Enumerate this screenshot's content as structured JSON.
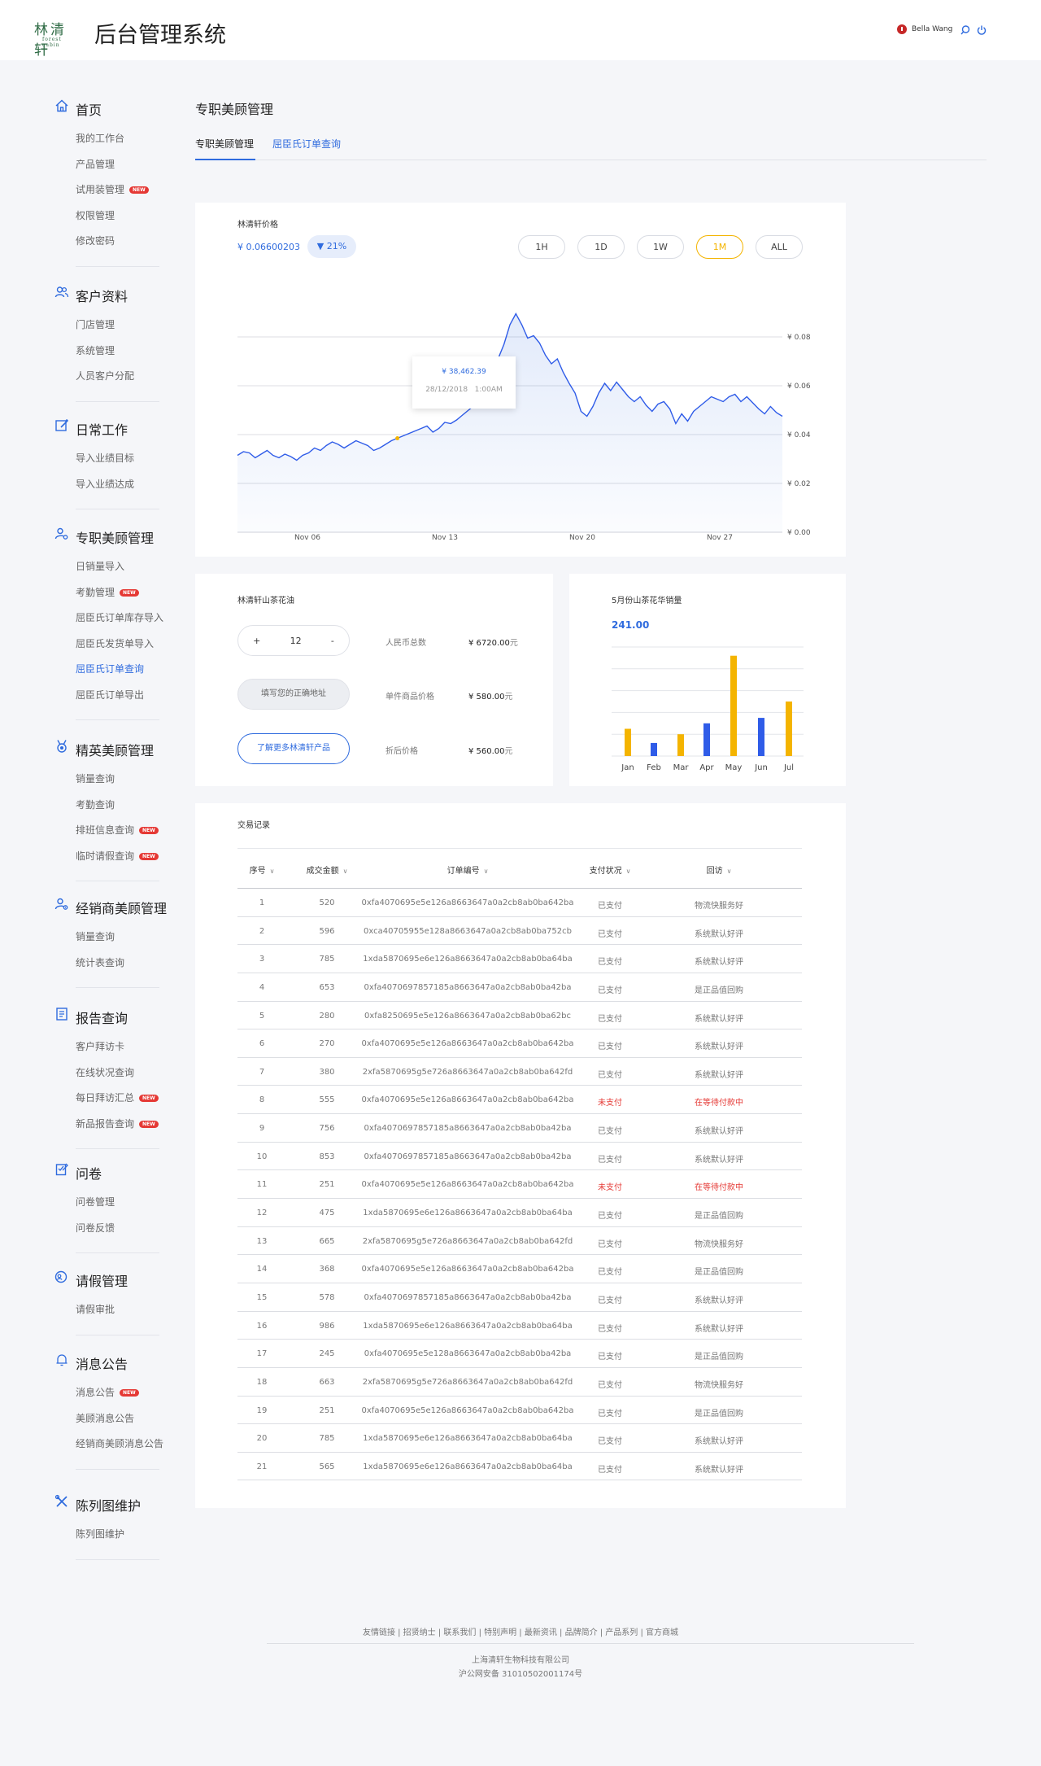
{
  "header": {
    "logo_text": "林清轩",
    "logo_sub": "forest cabin",
    "app_title": "后台管理系统",
    "user_name": "Bella Wang"
  },
  "sidebar": [
    {
      "title": "首页",
      "icon": "home-icon",
      "items": [
        {
          "label": "我的工作台"
        },
        {
          "label": "产品管理"
        },
        {
          "label": "试用装管理",
          "badge": "NEW"
        },
        {
          "label": "权限管理"
        },
        {
          "label": "修改密码"
        }
      ]
    },
    {
      "title": "客户资料",
      "icon": "users-icon",
      "items": [
        {
          "label": "门店管理"
        },
        {
          "label": "系统管理"
        },
        {
          "label": "人员客户分配"
        }
      ]
    },
    {
      "title": "日常工作",
      "icon": "edit-icon",
      "items": [
        {
          "label": "导入业绩目标"
        },
        {
          "label": "导入业绩达成"
        }
      ]
    },
    {
      "title": "专职美顾管理",
      "icon": "user-gear-icon",
      "items": [
        {
          "label": "日销量导入"
        },
        {
          "label": "考勤管理",
          "badge": "NEW"
        },
        {
          "label": "屈臣氏订单库存导入"
        },
        {
          "label": "屈臣氏发货单导入"
        },
        {
          "label": "屈臣氏订单查询",
          "active": true
        },
        {
          "label": "屈臣氏订单导出"
        }
      ]
    },
    {
      "title": "精英美顾管理",
      "icon": "medal-icon",
      "items": [
        {
          "label": "销量查询"
        },
        {
          "label": "考勤查询"
        },
        {
          "label": "排班信息查询",
          "badge": "NEW"
        },
        {
          "label": "临时请假查询",
          "badge": "NEW"
        }
      ]
    },
    {
      "title": "经销商美顾管理",
      "icon": "user-settings-icon",
      "items": [
        {
          "label": "销量查询"
        },
        {
          "label": "统计表查询"
        }
      ]
    },
    {
      "title": "报告查询",
      "icon": "report-icon",
      "items": [
        {
          "label": "客户拜访卡"
        },
        {
          "label": "在线状况查询"
        },
        {
          "label": "每日拜访汇总",
          "badge": "NEW"
        },
        {
          "label": "新品报告查询",
          "badge": "NEW"
        }
      ]
    },
    {
      "title": "问卷",
      "icon": "questionnaire-icon",
      "items": [
        {
          "label": "问卷管理"
        },
        {
          "label": "问卷反馈"
        }
      ]
    },
    {
      "title": "请假管理",
      "icon": "leave-icon",
      "items": [
        {
          "label": "请假审批"
        }
      ]
    },
    {
      "title": "消息公告",
      "icon": "bell-icon",
      "items": [
        {
          "label": "消息公告",
          "badge": "NEW"
        },
        {
          "label": "美顾消息公告"
        },
        {
          "label": "经销商美顾消息公告"
        }
      ]
    },
    {
      "title": "陈列图维护",
      "icon": "tools-icon",
      "items": [
        {
          "label": "陈列图维护"
        }
      ]
    }
  ],
  "main": {
    "page_title": "专职美顾管理",
    "tabs": [
      {
        "label": "专职美顾管理"
      },
      {
        "label": "屈臣氏订单查询"
      }
    ]
  },
  "price_card": {
    "title": "林清轩价格",
    "price": "¥ 0.06600203",
    "change": "▼ 21%",
    "ranges": [
      "1H",
      "1D",
      "1W",
      "1M",
      "ALL"
    ],
    "active_range": "1M",
    "tooltip_value": "¥ 38,462.39",
    "tooltip_date": "28/12/2018",
    "tooltip_time": "1:00AM"
  },
  "product_card": {
    "title": "林清轩山茶花油",
    "qty_minus": "-",
    "qty_plus": "+",
    "qty": "12",
    "address_placeholder": "填写您的正确地址",
    "more_button": "了解更多林清轩产品",
    "rows": [
      {
        "label": "人民币总数",
        "value": "¥ 6720.00",
        "unit": "元"
      },
      {
        "label": "单件商品价格",
        "value": "¥ 580.00",
        "unit": "元"
      },
      {
        "label": "折后价格",
        "value": "¥ 560.00",
        "unit": "元"
      }
    ]
  },
  "bar_card": {
    "title": "5月份山茶花华销量",
    "total": "241.00"
  },
  "chart_data": [
    {
      "type": "area",
      "title": "林清轩价格",
      "x_ticks": [
        "Nov 06",
        "Nov 13",
        "Nov 20",
        "Nov 27"
      ],
      "y_ticks": [
        "¥ 0.00",
        "¥ 0.02",
        "¥ 0.04",
        "¥ 0.06",
        "¥ 0.08"
      ],
      "ylim": [
        0,
        0.08
      ],
      "highlight_index": 27,
      "series": [
        {
          "values": [
            0.0315,
            0.033,
            0.0325,
            0.0305,
            0.032,
            0.0335,
            0.0315,
            0.0305,
            0.032,
            0.031,
            0.0295,
            0.0315,
            0.0325,
            0.0345,
            0.0335,
            0.0355,
            0.037,
            0.036,
            0.0345,
            0.036,
            0.0375,
            0.0365,
            0.0355,
            0.0335,
            0.0345,
            0.036,
            0.0375,
            0.0385,
            0.0395,
            0.0405,
            0.0415,
            0.0425,
            0.0435,
            0.041,
            0.0425,
            0.045,
            0.0445,
            0.046,
            0.048,
            0.05,
            0.052,
            0.0555,
            0.0595,
            0.064,
            0.071,
            0.077,
            0.085,
            0.0895,
            0.085,
            0.0795,
            0.0805,
            0.0775,
            0.0725,
            0.069,
            0.071,
            0.0655,
            0.061,
            0.057,
            0.0495,
            0.0475,
            0.0515,
            0.057,
            0.061,
            0.058,
            0.0615,
            0.0585,
            0.0555,
            0.0535,
            0.0555,
            0.052,
            0.0495,
            0.0525,
            0.0535,
            0.0505,
            0.0445,
            0.0485,
            0.0455,
            0.0495,
            0.0515,
            0.0535,
            0.0555,
            0.0545,
            0.0535,
            0.0555,
            0.0565,
            0.0535,
            0.0555,
            0.053,
            0.0505,
            0.0485,
            0.0515,
            0.049,
            0.0475
          ]
        }
      ]
    },
    {
      "type": "bar",
      "title": "5月份山茶花华销量",
      "categories": [
        "Jan",
        "Feb",
        "Mar",
        "Apr",
        "May",
        "Jun",
        "Jul"
      ],
      "values": [
        25,
        12,
        20,
        30,
        92,
        35,
        50
      ],
      "colors": [
        "#f4b400",
        "#2f5ce8",
        "#f4b400",
        "#2f5ce8",
        "#f4b400",
        "#2f5ce8",
        "#f4b400"
      ],
      "ylim": [
        0,
        100
      ],
      "grid": true
    }
  ],
  "table": {
    "title": "交易记录",
    "columns": [
      "序号",
      "成交金额",
      "订单编号",
      "支付状况",
      "回访"
    ],
    "rows": [
      [
        "1",
        "520",
        "0xfa4070695e5e126a8663647a0a2cb8ab0ba642ba",
        "已支付",
        "物流快服务好",
        false
      ],
      [
        "2",
        "596",
        "0xca40705955e128a8663647a0a2cb8ab0ba752cb",
        "已支付",
        "系统默认好评",
        false
      ],
      [
        "3",
        "785",
        "1xda5870695e6e126a8663647a0a2cb8ab0ba64ba",
        "已支付",
        "系统默认好评",
        false
      ],
      [
        "4",
        "653",
        "0xfa4070697857185a8663647a0a2cb8ab0ba42ba",
        "已支付",
        "是正品值回购",
        false
      ],
      [
        "5",
        "280",
        "0xfa8250695e5e126a8663647a0a2cb8ab0ba62bc",
        "已支付",
        "系统默认好评",
        false
      ],
      [
        "6",
        "270",
        "0xfa4070695e5e126a8663647a0a2cb8ab0ba642ba",
        "已支付",
        "系统默认好评",
        false
      ],
      [
        "7",
        "380",
        "2xfa5870695g5e726a8663647a0a2cb8ab0ba642fd",
        "已支付",
        "系统默认好评",
        false
      ],
      [
        "8",
        "555",
        "0xfa4070695e5e126a8663647a0a2cb8ab0ba642ba",
        "未支付",
        "在等待付款中",
        true
      ],
      [
        "9",
        "756",
        "0xfa4070697857185a8663647a0a2cb8ab0ba42ba",
        "已支付",
        "系统默认好评",
        false
      ],
      [
        "10",
        "853",
        "0xfa4070697857185a8663647a0a2cb8ab0ba42ba",
        "已支付",
        "系统默认好评",
        false
      ],
      [
        "11",
        "251",
        "0xfa4070695e5e126a8663647a0a2cb8ab0ba642ba",
        "未支付",
        "在等待付款中",
        true
      ],
      [
        "12",
        "475",
        "1xda5870695e6e126a8663647a0a2cb8ab0ba64ba",
        "已支付",
        "是正品值回购",
        false
      ],
      [
        "13",
        "665",
        "2xfa5870695g5e726a8663647a0a2cb8ab0ba642fd",
        "已支付",
        "物流快服务好",
        false
      ],
      [
        "14",
        "368",
        "0xfa4070695e5e126a8663647a0a2cb8ab0ba642ba",
        "已支付",
        "是正品值回购",
        false
      ],
      [
        "15",
        "578",
        "0xfa4070697857185a8663647a0a2cb8ab0ba42ba",
        "已支付",
        "系统默认好评",
        false
      ],
      [
        "16",
        "986",
        "1xda5870695e6e126a8663647a0a2cb8ab0ba64ba",
        "已支付",
        "系统默认好评",
        false
      ],
      [
        "17",
        "245",
        "0xfa4070695e5e128a8663647a0a2cb8ab0ba42ba",
        "已支付",
        "是正品值回购",
        false
      ],
      [
        "18",
        "663",
        "2xfa5870695g5e726a8663647a0a2cb8ab0ba642fd",
        "已支付",
        "物流快服务好",
        false
      ],
      [
        "19",
        "251",
        "0xfa4070695e5e126a8663647a0a2cb8ab0ba642ba",
        "已支付",
        "是正品值回购",
        false
      ],
      [
        "20",
        "785",
        "1xda5870695e6e126a8663647a0a2cb8ab0ba64ba",
        "已支付",
        "系统默认好评",
        false
      ],
      [
        "21",
        "565",
        "1xda5870695e6e126a8663647a0a2cb8ab0ba64ba",
        "已支付",
        "系统默认好评",
        false
      ]
    ]
  },
  "footer": {
    "links": "友情链接 | 招贤纳士 | 联系我们 | 特别声明 | 最新资讯 | 品牌简介 | 产品系列 | 官方商城",
    "company": "上海清轩生物科技有限公司",
    "icp": "沪公网安备 31010502001174号"
  },
  "colors": {
    "accent": "#2f6bde",
    "highlight": "#f4b400",
    "warning": "#e53935",
    "bar_blue": "#2f5ce8",
    "bar_yellow": "#f4b400"
  }
}
